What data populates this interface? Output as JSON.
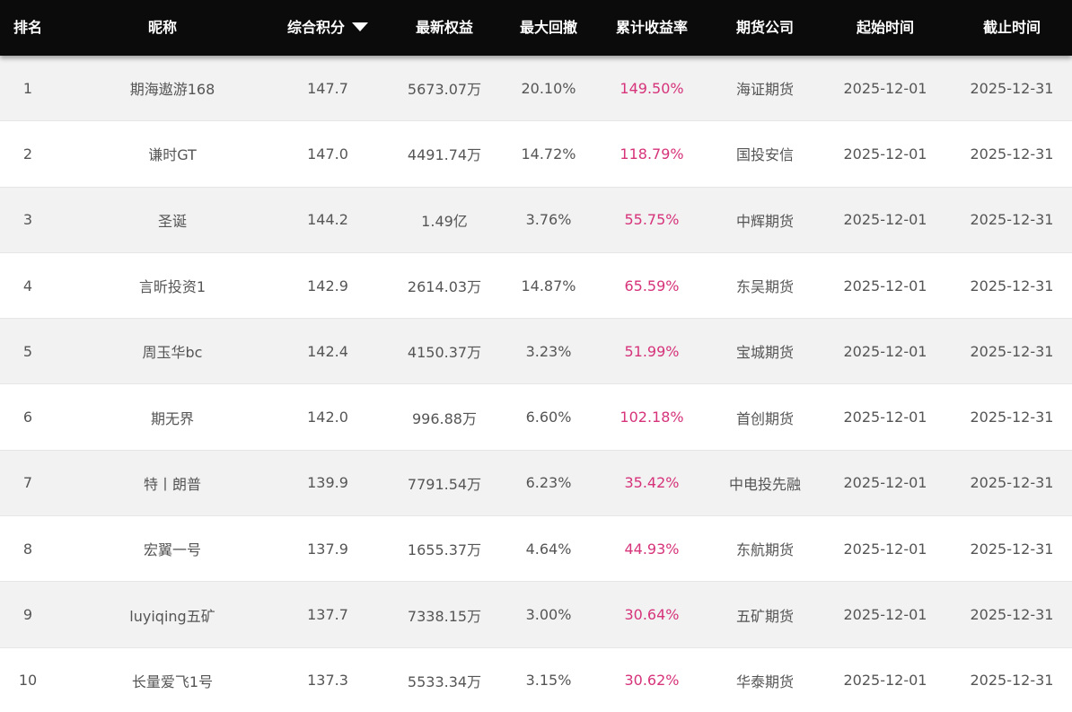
{
  "header": {
    "rank": "排名",
    "nickname": "昵称",
    "score": "综合积分",
    "equity": "最新权益",
    "drawdown": "最大回撤",
    "return": "累计收益率",
    "company": "期货公司",
    "start": "起始时间",
    "end": "截止时间"
  },
  "sort": {
    "column": "综合积分",
    "direction": "descending",
    "icon": "caret-down-icon"
  },
  "colors": {
    "header_bg": "#0b0b0b",
    "return_text": "#d6337a",
    "alt_row": "#f2f2f2"
  },
  "rows": [
    {
      "rank": "1",
      "nickname": "期海遨游168",
      "score": "147.7",
      "equity": "5673.07万",
      "drawdown": "20.10%",
      "return": "149.50%",
      "company": "海证期货",
      "start": "2025-12-01",
      "end": "2025-12-31"
    },
    {
      "rank": "2",
      "nickname": "谦时GT",
      "score": "147.0",
      "equity": "4491.74万",
      "drawdown": "14.72%",
      "return": "118.79%",
      "company": "国投安信",
      "start": "2025-12-01",
      "end": "2025-12-31"
    },
    {
      "rank": "3",
      "nickname": "圣诞",
      "score": "144.2",
      "equity": "1.49亿",
      "drawdown": "3.76%",
      "return": "55.75%",
      "company": "中辉期货",
      "start": "2025-12-01",
      "end": "2025-12-31"
    },
    {
      "rank": "4",
      "nickname": "言昕投资1",
      "score": "142.9",
      "equity": "2614.03万",
      "drawdown": "14.87%",
      "return": "65.59%",
      "company": "东吴期货",
      "start": "2025-12-01",
      "end": "2025-12-31"
    },
    {
      "rank": "5",
      "nickname": "周玉华bc",
      "score": "142.4",
      "equity": "4150.37万",
      "drawdown": "3.23%",
      "return": "51.99%",
      "company": "宝城期货",
      "start": "2025-12-01",
      "end": "2025-12-31"
    },
    {
      "rank": "6",
      "nickname": "期无界",
      "score": "142.0",
      "equity": "996.88万",
      "drawdown": "6.60%",
      "return": "102.18%",
      "company": "首创期货",
      "start": "2025-12-01",
      "end": "2025-12-31"
    },
    {
      "rank": "7",
      "nickname": "特丨朗普",
      "score": "139.9",
      "equity": "7791.54万",
      "drawdown": "6.23%",
      "return": "35.42%",
      "company": "中电投先融",
      "start": "2025-12-01",
      "end": "2025-12-31"
    },
    {
      "rank": "8",
      "nickname": "宏翼一号",
      "score": "137.9",
      "equity": "1655.37万",
      "drawdown": "4.64%",
      "return": "44.93%",
      "company": "东航期货",
      "start": "2025-12-01",
      "end": "2025-12-31"
    },
    {
      "rank": "9",
      "nickname": "luyiqing五矿",
      "score": "137.7",
      "equity": "7338.15万",
      "drawdown": "3.00%",
      "return": "30.64%",
      "company": "五矿期货",
      "start": "2025-12-01",
      "end": "2025-12-31"
    },
    {
      "rank": "10",
      "nickname": "长量爱飞1号",
      "score": "137.3",
      "equity": "5533.34万",
      "drawdown": "3.15%",
      "return": "30.62%",
      "company": "华泰期货",
      "start": "2025-12-01",
      "end": "2025-12-31"
    }
  ]
}
